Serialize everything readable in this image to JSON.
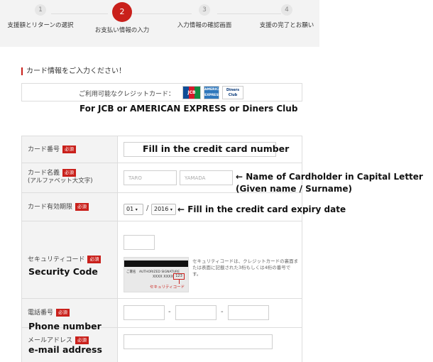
{
  "steps": [
    {
      "num": "1",
      "label": "支援額とリターンの選択"
    },
    {
      "num": "2",
      "label": "お支払い情報の入力"
    },
    {
      "num": "3",
      "label": "入力情報の確認画面"
    },
    {
      "num": "4",
      "label": "支援の完了とお願い"
    }
  ],
  "active_step": "2",
  "section_title": "カード情報をご入力ください！",
  "available_cards": {
    "label": "ご利用可能なクレジットカード：",
    "logos": [
      "JCB",
      "AMERICAN EXPRESS",
      "Diners Club"
    ]
  },
  "annotations": {
    "cards": "For JCB or AMERICAN EXPRESS or Diners Club",
    "card_number": "Fill in the credit card number",
    "name_line1": "← Name of Cardholder in Capital Letter",
    "name_line2": "(Given name / Surname)",
    "expiry": "← Fill in the credit card expiry date",
    "security": "Security Code",
    "phone": "Phone number",
    "email": "e-mail address"
  },
  "form": {
    "required_badge": "必須",
    "card_number": {
      "label": "カード番号"
    },
    "card_name": {
      "label": "カード名義",
      "sub": "(アルファベット大文字)",
      "first_placeholder": "TARO",
      "last_placeholder": "YAMADA"
    },
    "expiry": {
      "label": "カード有効期限",
      "month": "01",
      "year": "2016",
      "separator": "/"
    },
    "security": {
      "label": "セキュリティコード",
      "note": "セキュリティコードは、クレジットカードの裏面または表面に記載された3桁もしくは4桁の番号です。",
      "card_signature": "ご署名　AUTHORIZED SIGNATURE",
      "card_number_sample": "XXXX XXXX",
      "card_code_sample": "123",
      "card_caption": "セキュリティコード"
    },
    "phone": {
      "label": "電話番号",
      "separator": "-"
    },
    "email": {
      "label": "メールアドレス"
    }
  },
  "colors": {
    "accent": "#c9201b",
    "header_bg": "#f3f3f3",
    "border": "#dddddd"
  }
}
